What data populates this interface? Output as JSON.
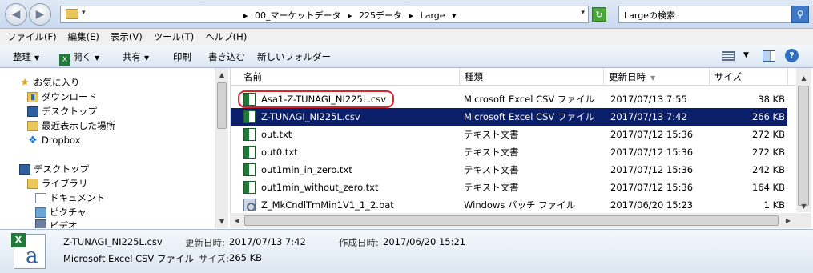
{
  "address": {
    "crumbs": [
      "00_マーケットデータ",
      "225データ",
      "Large"
    ]
  },
  "search": {
    "placeholder": "Largeの検索"
  },
  "menu": [
    "ファイル(F)",
    "編集(E)",
    "表示(V)",
    "ツール(T)",
    "ヘルプ(H)"
  ],
  "toolbar": {
    "organize": "整理",
    "open": "開く",
    "share": "共有",
    "print": "印刷",
    "burn": "書き込む",
    "new_folder": "新しいフォルダー"
  },
  "nav": {
    "favorites": "お気に入り",
    "downloads": "ダウンロード",
    "desktop_fav": "デスクトップ",
    "recent": "最近表示した場所",
    "dropbox": "Dropbox",
    "desktop": "デスクトップ",
    "libraries": "ライブラリ",
    "documents": "ドキュメント",
    "pictures": "ピクチャ",
    "videos": "ビデオ"
  },
  "columns": {
    "name": "名前",
    "type": "種類",
    "modified": "更新日時",
    "size": "サイズ"
  },
  "files": [
    {
      "name": "Asa1-Z-TUNAGI_NI225L.csv",
      "type": "Microsoft Excel CSV ファイル",
      "modified": "2017/07/13 7:55",
      "size": "38 KB",
      "icon": "csv-file-icon"
    },
    {
      "name": "Z-TUNAGI_NI225L.csv",
      "type": "Microsoft Excel CSV ファイル",
      "modified": "2017/07/13 7:42",
      "size": "266 KB",
      "icon": "csv-file-icon"
    },
    {
      "name": "out.txt",
      "type": "テキスト文書",
      "modified": "2017/07/12 15:36",
      "size": "272 KB",
      "icon": "text-file-icon"
    },
    {
      "name": "out0.txt",
      "type": "テキスト文書",
      "modified": "2017/07/12 15:36",
      "size": "272 KB",
      "icon": "text-file-icon"
    },
    {
      "name": "out1min_in_zero.txt",
      "type": "テキスト文書",
      "modified": "2017/07/12 15:36",
      "size": "242 KB",
      "icon": "text-file-icon"
    },
    {
      "name": "out1min_without_zero.txt",
      "type": "テキスト文書",
      "modified": "2017/07/12 15:36",
      "size": "164 KB",
      "icon": "text-file-icon"
    },
    {
      "name": "Z_MkCndlTmMin1V1_1_2.bat",
      "type": "Windows バッチ ファイル",
      "modified": "2017/06/20 15:23",
      "size": "1 KB",
      "icon": "batch-file-icon"
    }
  ],
  "selected_index": 1,
  "highlighted_index": 0,
  "details": {
    "filename": "Z-TUNAGI_NI225L.csv",
    "filetype": "Microsoft Excel CSV ファイル",
    "modified_label": "更新日時:",
    "modified": "2017/07/13 7:42",
    "created_label": "作成日時:",
    "created": "2017/06/20 15:21",
    "size_label": "サイズ:",
    "size": "265 KB"
  },
  "colors": {
    "selection": "#0b1f6b",
    "highlight_ring": "#d9252c"
  }
}
